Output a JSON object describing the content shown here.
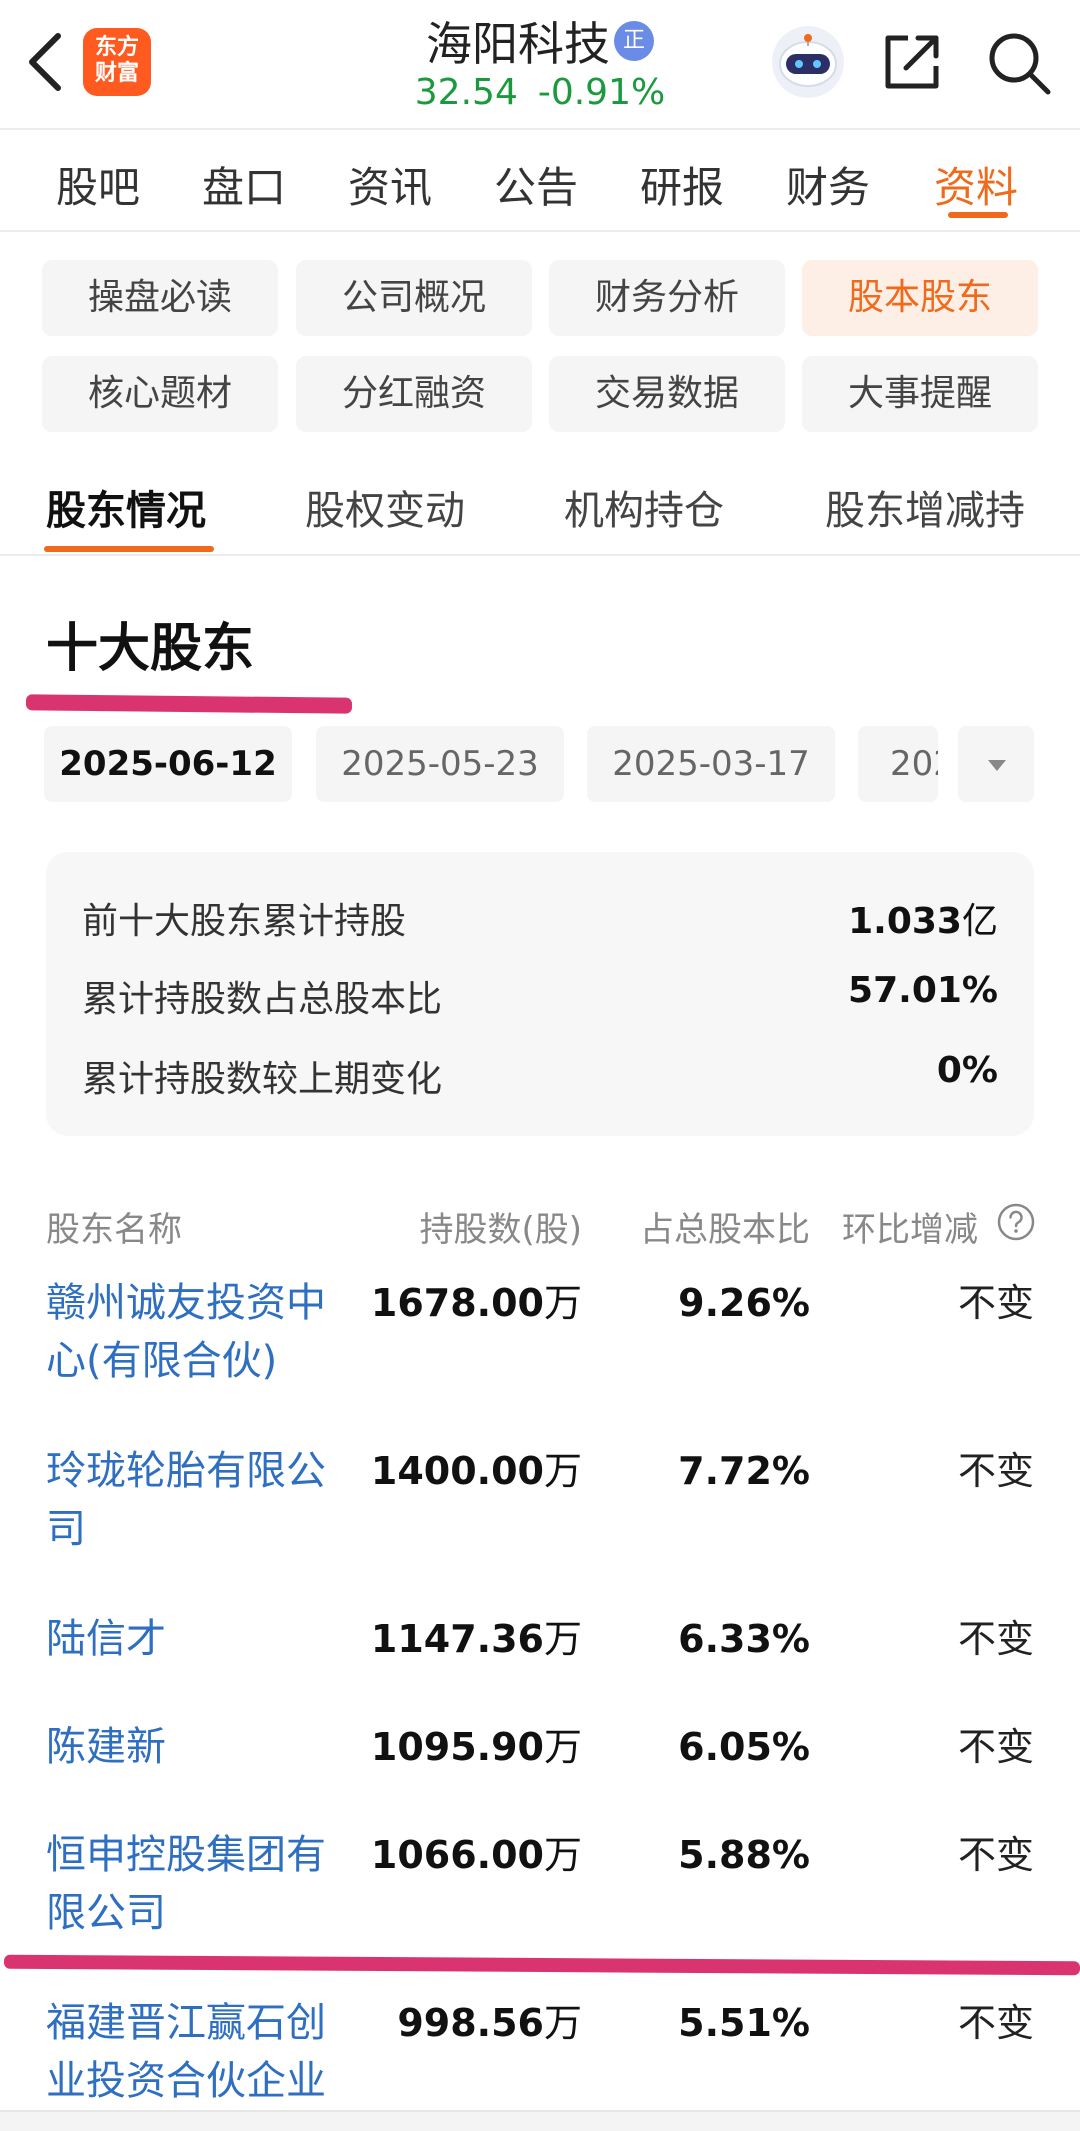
{
  "header": {
    "stock_name": "海阳科技",
    "badge": "正",
    "logo_line1": "东方",
    "logo_line2": "财富",
    "price": "32.54",
    "change": "-0.91%"
  },
  "main_tabs": [
    "股吧",
    "盘口",
    "资讯",
    "公告",
    "研报",
    "财务",
    "资料"
  ],
  "sub_tabs": [
    "操盘必读",
    "公司概况",
    "财务分析",
    "股本股东",
    "核心题材",
    "分红融资",
    "交易数据",
    "大事提醒"
  ],
  "section_tabs": [
    "股东情况",
    "股权变动",
    "机构持仓",
    "股东增减持"
  ],
  "section_title": "十大股东",
  "dates": [
    "2025-06-12",
    "2025-05-23",
    "2025-03-17",
    "202"
  ],
  "summary": {
    "total_label": "前十大股东累计持股",
    "total_value": "1.033",
    "total_unit": "亿",
    "ratio_label": "累计持股数占总股本比",
    "ratio_value": "57.01%",
    "change_label": "累计持股数较上期变化",
    "change_value": "0%"
  },
  "table": {
    "headers": [
      "股东名称",
      "持股数(股)",
      "占总股本比",
      "环比增减"
    ],
    "rows": [
      {
        "name": "赣州诚友投资中心(有限合伙)",
        "shares": "1678.00",
        "unit": "万",
        "ratio": "9.26%",
        "change": "不变"
      },
      {
        "name": "玲珑轮胎有限公司",
        "shares": "1400.00",
        "unit": "万",
        "ratio": "7.72%",
        "change": "不变"
      },
      {
        "name": "陆信才",
        "shares": "1147.36",
        "unit": "万",
        "ratio": "6.33%",
        "change": "不变"
      },
      {
        "name": "陈建新",
        "shares": "1095.90",
        "unit": "万",
        "ratio": "6.05%",
        "change": "不变"
      },
      {
        "name": "恒申控股集团有限公司",
        "shares": "1066.00",
        "unit": "万",
        "ratio": "5.88%",
        "change": "不变"
      },
      {
        "name": "福建晋江赢石创业投资合伙企业",
        "shares": "998.56",
        "unit": "万",
        "ratio": "5.51%",
        "change": "不变"
      }
    ]
  },
  "colors": {
    "accent": "#f06a1b",
    "up_down_green": "#1a9a3c",
    "link_blue": "#2f6fc1",
    "annotation_pink": "#d9346f"
  }
}
